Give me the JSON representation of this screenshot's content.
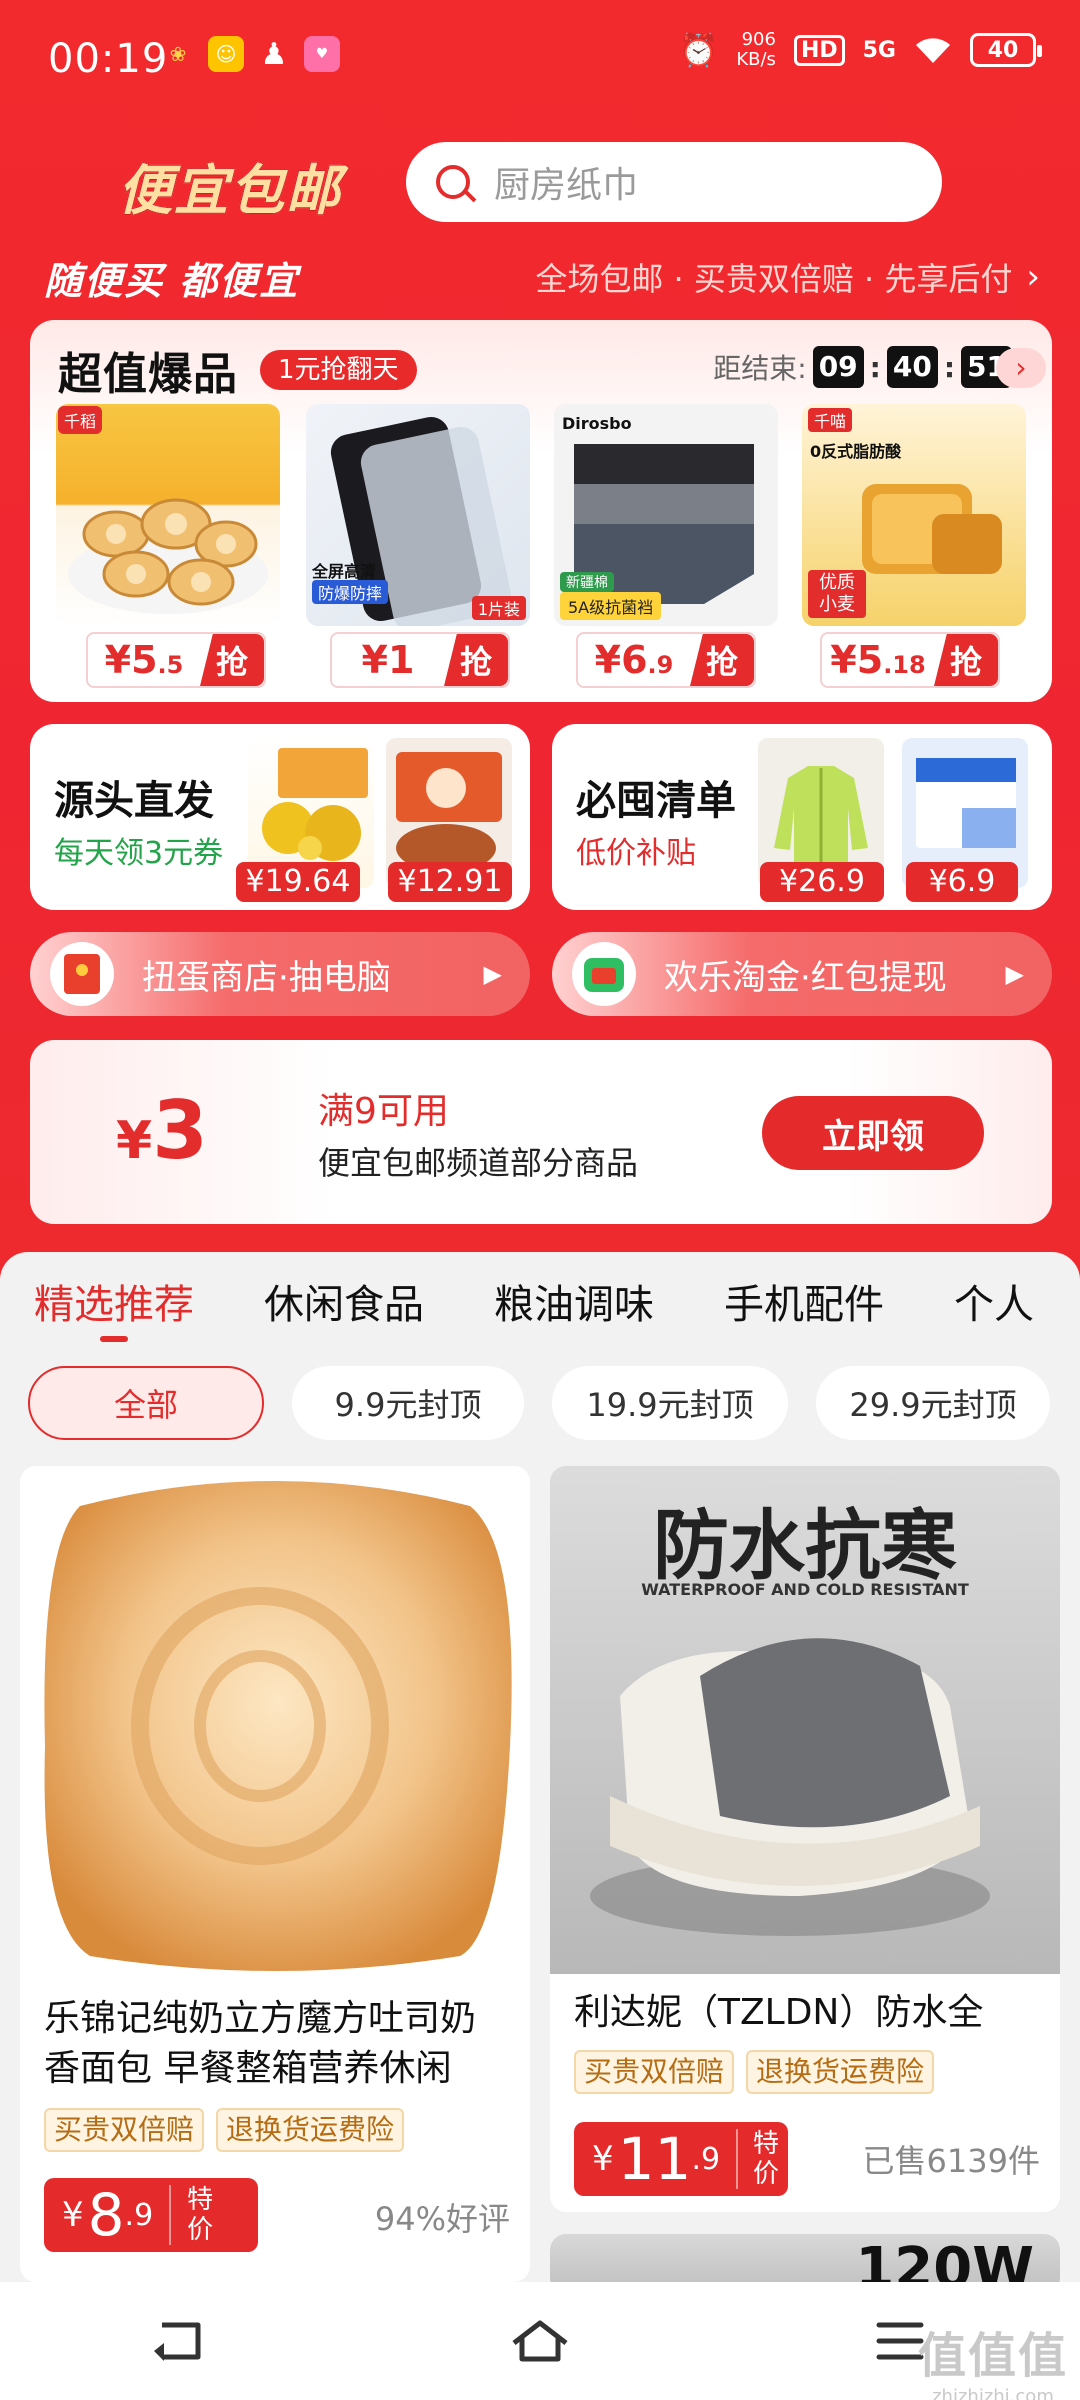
{
  "status_bar": {
    "time": "00:19",
    "net_speed": "906",
    "net_unit": "KB/s",
    "hd": "HD",
    "signal": "5G",
    "battery": "40"
  },
  "header": {
    "logo_text": "便宜包邮",
    "search_placeholder": "厨房纸巾",
    "slogan": "随便买 都便宜",
    "benefits": "全场包邮 · 买贵双倍赔 · 先享后付"
  },
  "flash_sale": {
    "title": "超值爆品",
    "badge": "1元抢翻天",
    "countdown_label": "距结束:",
    "countdown": [
      "09",
      "40",
      "51"
    ],
    "buy_label": "抢",
    "products": [
      {
        "price_main": "¥5",
        "price_dec": ".5",
        "name": "egg-roll-biscuits"
      },
      {
        "price_main": "¥1",
        "price_dec": "",
        "name": "screen-protector"
      },
      {
        "price_main": "¥6",
        "price_dec": ".9",
        "name": "mens-underwear"
      },
      {
        "price_main": "¥5",
        "price_dec": ".18",
        "name": "toast-bread"
      }
    ],
    "product_overlays": {
      "p1_brand": "千稻",
      "p2_text1": "全屏高清",
      "p2_text2": "防爆防摔",
      "p2_tag": "1片装",
      "p3_brand": "Dirosbo",
      "p3_text": "5A级抗菌裆",
      "p3_sub": "新疆棉",
      "p4_brand": "千喵",
      "p4_text": "0反式脂肪酸",
      "p4_tag": "优质小麦"
    }
  },
  "source_direct": {
    "title": "源头直发",
    "subtitle": "每天领3元券",
    "prices": [
      "¥19.64",
      "¥12.91"
    ]
  },
  "must_stock": {
    "title": "必囤清单",
    "subtitle": "低价补贴",
    "prices": [
      "¥26.9",
      "¥6.9"
    ]
  },
  "pills": [
    {
      "label": "扭蛋商店·抽电脑",
      "icon": "red-envelope-icon"
    },
    {
      "label": "欢乐淘金·红包提现",
      "icon": "green-wallet-icon"
    }
  ],
  "coupon": {
    "amount": "3",
    "currency": "¥",
    "condition": "满9可用",
    "scope": "便宜包邮频道部分商品",
    "button": "立即领"
  },
  "category_tabs": [
    "精选推荐",
    "休闲食品",
    "粮油调味",
    "手机配件",
    "个人"
  ],
  "filter_chips": [
    "全部",
    "9.9元封顶",
    "19.9元封顶",
    "29.9元封顶"
  ],
  "products": [
    {
      "name_line1": "乐锦记纯奶立方魔方吐司奶",
      "name_line2": "香面包 早餐整箱营养休闲",
      "tags": [
        "买贵双倍赔",
        "退换货运费险"
      ],
      "price_int": "8",
      "price_dec": ".9",
      "special": "特价",
      "meta": "94%好评"
    },
    {
      "name_line1": "利达妮（TZLDN）防水全",
      "tags": [
        "买贵双倍赔",
        "退换货运费险"
      ],
      "price_int": "11",
      "price_dec": ".9",
      "special": "特价",
      "meta": "已售6139件",
      "image_title": "防水抗寒",
      "image_subtitle": "WATERPROOF AND COLD RESISTANT"
    }
  ],
  "next_card_peek": "120W",
  "watermark": {
    "big": "值值值",
    "small": "zhizhizhi.com"
  },
  "colors": {
    "brand_red": "#e42a2a",
    "gold_tag": "#b56c12"
  }
}
